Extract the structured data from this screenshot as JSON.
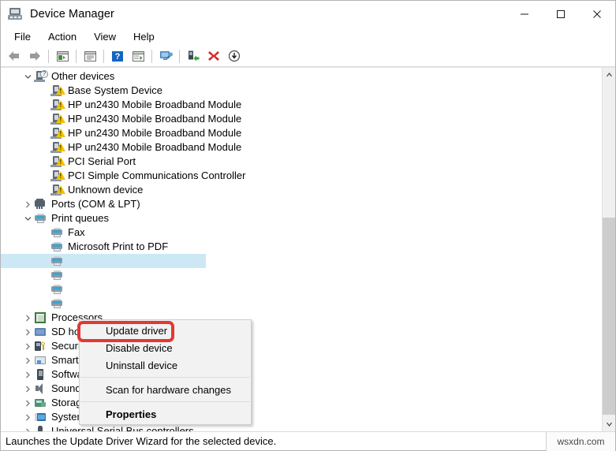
{
  "window": {
    "title": "Device Manager",
    "icon": "device-manager-icon",
    "controls": [
      {
        "name": "minimize",
        "glyph": "minimize-icon"
      },
      {
        "name": "maximize",
        "glyph": "maximize-icon"
      },
      {
        "name": "close",
        "glyph": "close-icon"
      }
    ]
  },
  "menubar": {
    "items": [
      {
        "label": "File"
      },
      {
        "label": "Action"
      },
      {
        "label": "View"
      },
      {
        "label": "Help"
      }
    ]
  },
  "toolbar": {
    "buttons": [
      {
        "name": "back-icon"
      },
      {
        "name": "forward-icon"
      },
      {
        "sep": true
      },
      {
        "name": "show-hide-console-tree-icon"
      },
      {
        "sep": true
      },
      {
        "name": "properties-icon"
      },
      {
        "sep": true
      },
      {
        "name": "help-icon"
      },
      {
        "name": "show-hide-action-pane-icon"
      },
      {
        "sep": true
      },
      {
        "name": "scan-for-hardware-changes-icon"
      },
      {
        "sep": true
      },
      {
        "name": "update-driver-icon"
      },
      {
        "name": "uninstall-device-icon"
      },
      {
        "name": "disable-device-icon"
      }
    ]
  },
  "tree": {
    "rows": [
      {
        "label": "Other devices",
        "indent": 0,
        "chev": "down",
        "icon": "device-unknown-icon",
        "badge": "question"
      },
      {
        "label": "Base System Device",
        "indent": 1,
        "chev": "none",
        "icon": "device-warning-icon",
        "badge": "warning"
      },
      {
        "label": "HP un2430 Mobile Broadband Module",
        "indent": 1,
        "chev": "none",
        "icon": "device-warning-icon",
        "badge": "warning"
      },
      {
        "label": "HP un2430 Mobile Broadband Module",
        "indent": 1,
        "chev": "none",
        "icon": "device-warning-icon",
        "badge": "warning"
      },
      {
        "label": "HP un2430 Mobile Broadband Module",
        "indent": 1,
        "chev": "none",
        "icon": "device-warning-icon",
        "badge": "warning"
      },
      {
        "label": "HP un2430 Mobile Broadband Module",
        "indent": 1,
        "chev": "none",
        "icon": "device-warning-icon",
        "badge": "warning"
      },
      {
        "label": "PCI Serial Port",
        "indent": 1,
        "chev": "none",
        "icon": "device-warning-icon",
        "badge": "warning"
      },
      {
        "label": "PCI Simple Communications Controller",
        "indent": 1,
        "chev": "none",
        "icon": "device-warning-icon",
        "badge": "warning"
      },
      {
        "label": "Unknown device",
        "indent": 1,
        "chev": "none",
        "icon": "device-warning-icon",
        "badge": "warning"
      },
      {
        "label": "Ports (COM & LPT)",
        "indent": 0,
        "chev": "right",
        "icon": "port-icon",
        "badge": "none"
      },
      {
        "label": "Print queues",
        "indent": 0,
        "chev": "down",
        "icon": "printer-icon",
        "badge": "none"
      },
      {
        "label": "Fax",
        "indent": 1,
        "chev": "none",
        "icon": "printer-icon",
        "badge": "none"
      },
      {
        "label": "Microsoft Print to PDF",
        "indent": 1,
        "chev": "none",
        "icon": "printer-icon",
        "badge": "none"
      },
      {
        "label": "",
        "indent": 1,
        "chev": "none",
        "icon": "printer-icon",
        "badge": "none",
        "selected": true
      },
      {
        "label": "",
        "indent": 1,
        "chev": "none",
        "icon": "printer-icon",
        "badge": "none"
      },
      {
        "label": "",
        "indent": 1,
        "chev": "none",
        "icon": "printer-icon",
        "badge": "none"
      },
      {
        "label": "",
        "indent": 1,
        "chev": "none",
        "icon": "printer-icon",
        "badge": "none"
      },
      {
        "label": "Processors",
        "indent": 0,
        "chev": "right",
        "icon": "processor-icon",
        "badge": "none"
      },
      {
        "label": "SD host adapters",
        "indent": 0,
        "chev": "right",
        "icon": "sd-host-icon",
        "badge": "none"
      },
      {
        "label": "Security devices",
        "indent": 0,
        "chev": "right",
        "icon": "security-device-icon",
        "badge": "none"
      },
      {
        "label": "Smart card readers",
        "indent": 0,
        "chev": "right",
        "icon": "smart-card-reader-icon",
        "badge": "none"
      },
      {
        "label": "Software devices",
        "indent": 0,
        "chev": "right",
        "icon": "software-device-icon",
        "badge": "none"
      },
      {
        "label": "Sound, video and game controllers",
        "indent": 0,
        "chev": "right",
        "icon": "sound-device-icon",
        "badge": "none"
      },
      {
        "label": "Storage controllers",
        "indent": 0,
        "chev": "right",
        "icon": "storage-controller-icon",
        "badge": "none"
      },
      {
        "label": "System devices",
        "indent": 0,
        "chev": "right",
        "icon": "system-device-icon",
        "badge": "none"
      },
      {
        "label": "Universal Serial Bus controllers",
        "indent": 0,
        "chev": "right",
        "icon": "usb-controller-icon",
        "badge": "none"
      }
    ]
  },
  "context_menu": {
    "items": [
      {
        "label": "Update driver",
        "type": "item",
        "bold": false,
        "highlighted": true
      },
      {
        "label": "Disable device",
        "type": "item",
        "bold": false
      },
      {
        "label": "Uninstall device",
        "type": "item",
        "bold": false
      },
      {
        "type": "separator"
      },
      {
        "label": "Scan for hardware changes",
        "type": "item",
        "bold": false
      },
      {
        "type": "separator"
      },
      {
        "label": "Properties",
        "type": "item",
        "bold": true
      }
    ]
  },
  "annotation": {
    "color": "#e03a32",
    "target": "Update driver"
  },
  "statusbar": {
    "text": "Launches the Update Driver Wizard for the selected device.",
    "watermark": "wsxdn.com"
  },
  "scrollbar": {
    "up": "scroll-up-arrow-icon",
    "down": "scroll-down-arrow-icon"
  }
}
